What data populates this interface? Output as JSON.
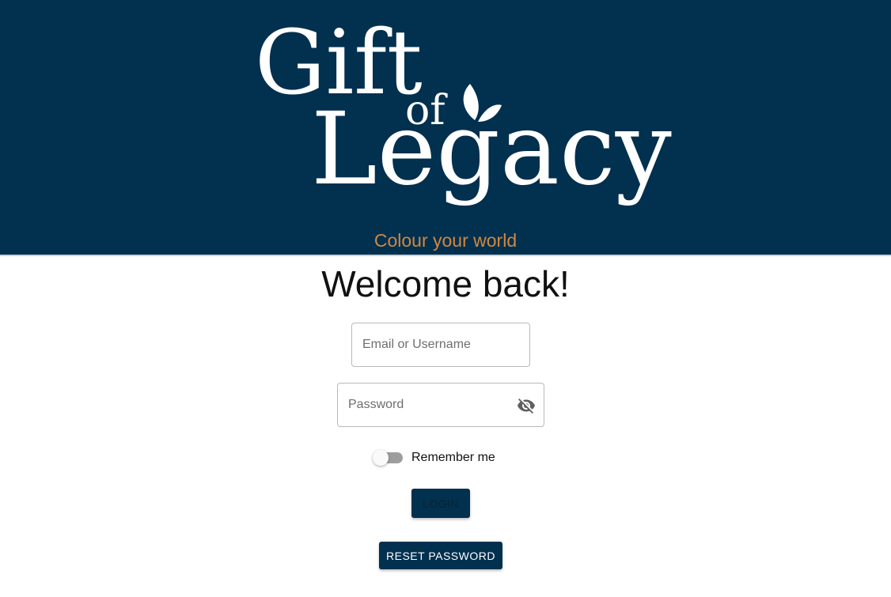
{
  "header": {
    "logo": {
      "line1": "Gift",
      "line2": "of",
      "line3": "Legacy"
    },
    "tagline": "Colour your world"
  },
  "form": {
    "title": "Welcome back!",
    "email_placeholder": "Email or Username",
    "email_value": "",
    "password_placeholder": "Password",
    "password_value": "",
    "password_toggle_icon": "eye-off-icon",
    "remember_label": "Remember me",
    "remember_checked": false,
    "login_label": "LOGIN",
    "reset_label": "RESET PASSWORD"
  },
  "colors": {
    "brand_navy": "#02304f",
    "tagline_orange": "#d3883e"
  }
}
